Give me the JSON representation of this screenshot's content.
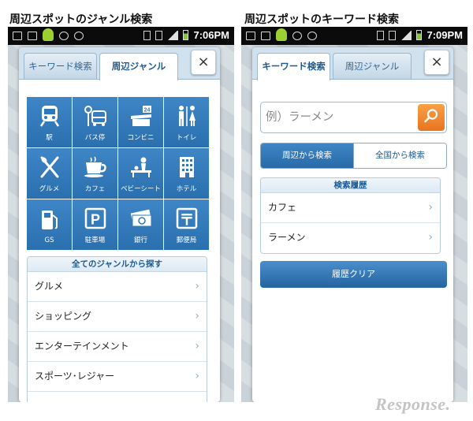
{
  "left_screen": {
    "caption": "周辺スポットのジャンル検索",
    "status_time": "7:06PM",
    "tabs": [
      {
        "label": "キーワード検索",
        "active": false
      },
      {
        "label": "周辺ジャンル",
        "active": true
      }
    ],
    "close_label": "×",
    "genres": [
      {
        "label": "駅",
        "icon": "train-icon"
      },
      {
        "label": "バス停",
        "icon": "bus-stop-icon"
      },
      {
        "label": "コンビニ",
        "icon": "convenience-store-icon",
        "badge": "24"
      },
      {
        "label": "トイレ",
        "icon": "restroom-icon"
      },
      {
        "label": "グルメ",
        "icon": "fork-knife-icon"
      },
      {
        "label": "カフェ",
        "icon": "coffee-cup-icon"
      },
      {
        "label": "ベビーシート",
        "icon": "baby-sheet-icon"
      },
      {
        "label": "ホテル",
        "icon": "hotel-icon"
      },
      {
        "label": "GS",
        "icon": "gas-pump-icon"
      },
      {
        "label": "駐車場",
        "icon": "parking-icon",
        "glyph": "P"
      },
      {
        "label": "銀行",
        "icon": "bank-notes-icon"
      },
      {
        "label": "郵便局",
        "icon": "post-office-icon",
        "glyph": "〒"
      }
    ],
    "all_genres": {
      "header": "全てのジャンルから探す",
      "items": [
        "グルメ",
        "ショッピング",
        "エンターテインメント",
        "スポーツ･レジャー"
      ]
    }
  },
  "right_screen": {
    "caption": "周辺スポットのキーワード検索",
    "status_time": "7:09PM",
    "tabs": [
      {
        "label": "キーワード検索",
        "active": true
      },
      {
        "label": "周辺ジャンル",
        "active": false
      }
    ],
    "close_label": "×",
    "search": {
      "placeholder": "例）ラーメン",
      "value": ""
    },
    "scope": {
      "nearby": "周辺から検索",
      "nationwide": "全国から検索",
      "selected": "nearby"
    },
    "history": {
      "header": "検索履歴",
      "items": [
        "カフェ",
        "ラーメン"
      ]
    },
    "clear_button": "履歴クリア"
  },
  "watermark": "Response.",
  "colors": {
    "accent_blue": "#2f78b9",
    "search_orange": "#ee7d22",
    "status_bar": "#0b0b0b",
    "dialog_frame": "#d2e1ee"
  }
}
